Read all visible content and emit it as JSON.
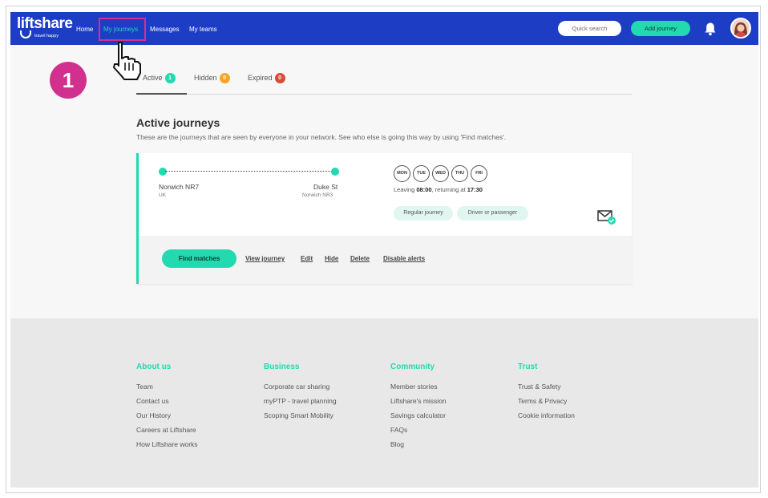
{
  "brand": {
    "name": "liftshare",
    "tagline": "travel happy",
    "accent": "#22d9b0",
    "nav_bg": "#1d3ec4",
    "highlight": "#d1308f"
  },
  "nav": {
    "links": [
      "Home",
      "My journeys",
      "Messages",
      "My teams"
    ],
    "active": "My journeys",
    "quick_search": "Quick search",
    "add_journey": "Add journey"
  },
  "step_badge": "1",
  "tabs": [
    {
      "label": "Active",
      "count": "1",
      "color": "#22d9b0"
    },
    {
      "label": "Hidden",
      "count": "0",
      "color": "#f5a623"
    },
    {
      "label": "Expired",
      "count": "0",
      "color": "#d84a3a"
    }
  ],
  "section": {
    "title": "Active journeys",
    "description": "These are the journeys that are seen by everyone in your network. See who else is going this way by using 'Find matches'."
  },
  "journey": {
    "from": {
      "name": "Norwich NR7",
      "sub": "UK"
    },
    "to": {
      "name": "Duke St",
      "sub": "Norwich NR3"
    },
    "days": [
      "MON",
      "TUE",
      "WED",
      "THU",
      "FRI"
    ],
    "times": {
      "leaving_prefix": "Leaving",
      "leaving": "08:00",
      "returning_prefix": ", returning at",
      "returning": "17:30"
    },
    "tags": [
      "Regular journey",
      "Driver or passenger"
    ],
    "actions": {
      "find_matches": "Find matches",
      "links": [
        "View journey",
        "Edit",
        "Hide",
        "Delete",
        "Disable alerts"
      ]
    }
  },
  "footer": {
    "columns": [
      {
        "heading": "About us",
        "items": [
          "Team",
          "Contact us",
          "Our History",
          "Careers at Liftshare",
          "How Liftshare works"
        ]
      },
      {
        "heading": "Business",
        "items": [
          "Corporate car sharing",
          "myPTP - travel planning",
          "Scoping Smart Mobility"
        ]
      },
      {
        "heading": "Community",
        "items": [
          "Member stories",
          "Liftshare's mission",
          "Savings calculator",
          "FAQs",
          "Blog"
        ]
      },
      {
        "heading": "Trust",
        "items": [
          "Trust & Safety",
          "Terms & Privacy",
          "Cookie information"
        ]
      }
    ]
  }
}
